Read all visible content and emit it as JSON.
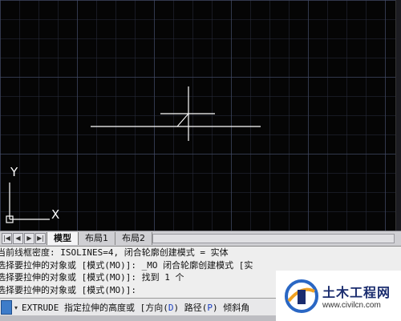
{
  "ucs": {
    "y_label": "Y",
    "x_label": "X"
  },
  "tabs": {
    "items": [
      {
        "label": "模型",
        "active": true
      },
      {
        "label": "布局1",
        "active": false
      },
      {
        "label": "布局2",
        "active": false
      }
    ]
  },
  "command_history": [
    "当前线框密度:  ISOLINES=4, 闭合轮廓创建模式 = 实体",
    "选择要拉伸的对象或 [模式(MO)]: _MO 闭合轮廓创建模式 [实",
    "选择要拉伸的对象或 [模式(MO)]: 找到 1 个",
    "选择要拉伸的对象或 [模式(MO)]:"
  ],
  "command_prompt": {
    "command": "EXTRUDE",
    "prompt": "指定拉伸的高度或",
    "options": [
      {
        "name": "方向",
        "key": "D"
      },
      {
        "name": "路径",
        "key": "P"
      },
      {
        "name": "倾斜角",
        "key": ""
      }
    ]
  },
  "watermark": {
    "title": "土木工程网",
    "url": "www.civilcn.com"
  },
  "colors": {
    "canvas": "#050505",
    "geometry": "#ffffff",
    "command_bg": "#eeeeee",
    "option_key": "#1a3fc0"
  }
}
